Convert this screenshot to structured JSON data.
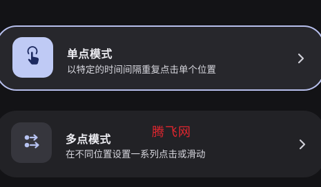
{
  "modes": [
    {
      "title": "单点模式",
      "description": "以特定的时间间隔重复点击单个位置",
      "icon": "tap-gesture-icon",
      "selected": true
    },
    {
      "title": "多点模式",
      "description": "在不同位置设置一系列点击或滑动",
      "icon": "multi-point-swipe-icon",
      "selected": false
    }
  ],
  "watermark": "腾飞网",
  "colors": {
    "background": "#131316",
    "card": "#27272c",
    "selected_border": "#b8c0ee",
    "selected_icon_bg": "#bfcaf5",
    "icon_bg": "#36363d",
    "accent_icon": "#b7c3f2",
    "watermark": "#e0262f"
  }
}
